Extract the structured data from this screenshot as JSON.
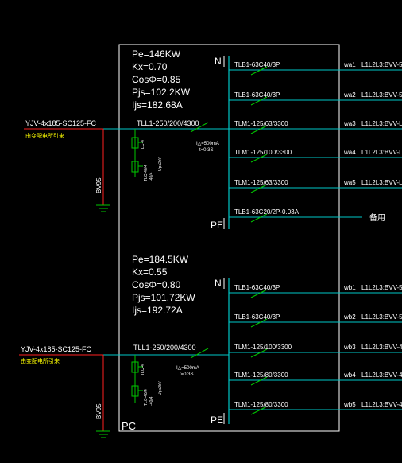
{
  "panel_top": {
    "params": {
      "pe": "Pe=146KW",
      "kx": "Kx=0.70",
      "cos": "CosΦ=0.85",
      "pjs": "Pjs=102.2KW",
      "ijs": "Ijs=182.68A"
    },
    "incoming_cable": "YJV-4x185-SC125-FC",
    "incoming_note": "由变配电所引来",
    "ground_wire": "BV95",
    "main_breaker": "TLL1-250/200/4300",
    "rcd_note_1": "I△=500mA",
    "rcd_note_2": "t=0.3S",
    "n_label": "N",
    "pe_label": "PE",
    "circuits": [
      {
        "breaker": "TLB1-63C40/3P",
        "id": "wa1",
        "cable": "L1L2L3:BVV-5"
      },
      {
        "breaker": "TLB1-63C40/3P",
        "id": "wa2",
        "cable": "L1L2L3:BVV-5"
      },
      {
        "breaker": "TLM1-125/63/3300",
        "id": "wa3",
        "cable": "L1L2L3:BVV-L"
      },
      {
        "breaker": "TLM1-125/100/3300",
        "id": "wa4",
        "cable": "L1L2L3:BVV-L"
      },
      {
        "breaker": "TLM1-125/63/3300",
        "id": "wa5",
        "cable": "L1L2L3:BVV-L"
      }
    ],
    "spare_breaker": "TLB1-63C20/2P-0.03A",
    "spare_label": "备用"
  },
  "panel_bottom": {
    "params": {
      "pe": "Pe=184.5KW",
      "kx": "Kx=0.55",
      "cos": "CosΦ=0.80",
      "pjs": "Pjs=101.72KW",
      "ijs": "Ijs=192.72A"
    },
    "incoming_cable": "YJV-4x185-SC125-FC",
    "incoming_note": "由变配电所引来",
    "ground_wire": "BV95",
    "main_breaker": "TLL1-250/200/4300",
    "rcd_note_1": "I△=500mA",
    "rcd_note_2": "t=0.3S",
    "n_label": "N",
    "pe_label": "PE",
    "circuits": [
      {
        "breaker": "TLB1-63C40/3P",
        "id": "wb1",
        "cable": "L1L2L3:BVV-5"
      },
      {
        "breaker": "TLB1-63C40/3P",
        "id": "wb2",
        "cable": "L1L2L3:BVV-5"
      },
      {
        "breaker": "TLM1-125/100/3300",
        "id": "wb3",
        "cable": "L1L2L3:BVV-4"
      },
      {
        "breaker": "TLM1-125/80/3300",
        "id": "wb4",
        "cable": "L1L2L3:BVV-4"
      },
      {
        "breaker": "TLM1-125/80/3300",
        "id": "wb5",
        "cable": "L1L2L3:BVV-4"
      }
    ]
  },
  "frame_tag": "PC",
  "colors": {
    "background": "#000000",
    "wire": "#00c8c8",
    "breaker": "#00c800",
    "ground": "#00c800",
    "feeder_in": "#ff2020",
    "frame": "#ffffff",
    "text": "#ffffff",
    "note": "#ffff00"
  }
}
